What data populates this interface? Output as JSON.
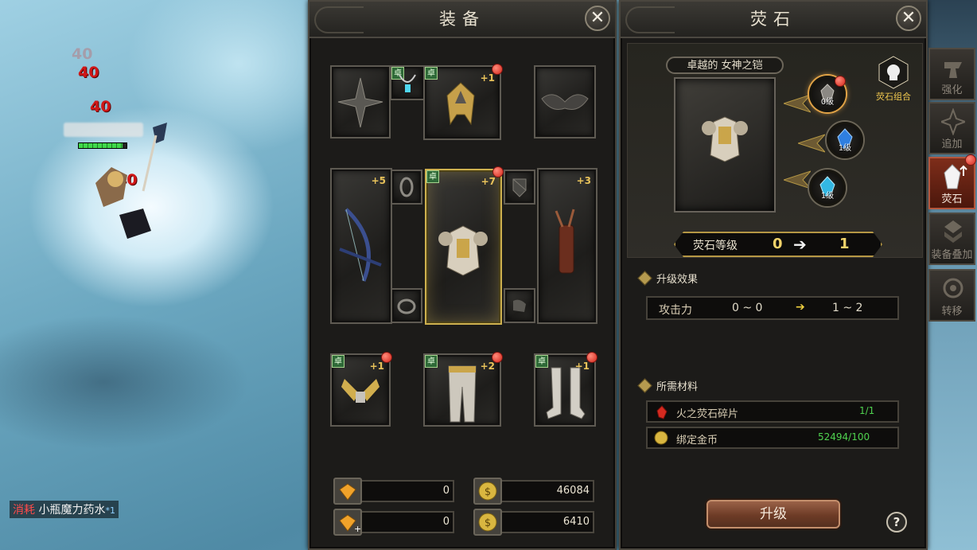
{
  "world": {
    "damage_numbers": [
      "40",
      "40",
      "40",
      "40"
    ],
    "consume": {
      "tag": "消耗",
      "item": "小瓶魔力药水",
      "count": "*1"
    },
    "hp_fraction": 0.92
  },
  "equip_panel": {
    "title": "装备",
    "close_icon": "close-icon",
    "badge_text": "卓",
    "slots": {
      "weapon_top_left": {
        "plus": ""
      },
      "necklace": {},
      "helmet": {
        "plus": "+1"
      },
      "wings": {},
      "bow": {
        "plus": "+5"
      },
      "ring_top": {},
      "armor": {
        "plus": "+7"
      },
      "shield_small": {},
      "quiver": {
        "plus": "+3"
      },
      "ring_bottom": {},
      "boots_small": {},
      "gloves": {
        "plus": "+1"
      },
      "pants": {
        "plus": "+2"
      },
      "boots": {
        "plus": "+1"
      }
    },
    "currencies": [
      {
        "icon": "gem-icon",
        "value": "0"
      },
      {
        "icon": "coin-icon",
        "value": "46084"
      },
      {
        "icon": "gem-plus-icon",
        "value": "0"
      },
      {
        "icon": "coin-icon",
        "value": "6410"
      }
    ]
  },
  "gem_panel": {
    "title": "荧石",
    "item_name": "卓越的 女神之铠",
    "combo_label": "荧石组合",
    "orbs": [
      {
        "label": "0级"
      },
      {
        "label": "1级"
      },
      {
        "label": "1级"
      }
    ],
    "level": {
      "label": "荧石等级",
      "from": "0",
      "to": "1"
    },
    "effect_title": "升级效果",
    "effect": {
      "stat": "攻击力",
      "from": "0 ~ 0",
      "to": "1 ~ 2"
    },
    "materials_title": "所需材料",
    "materials": [
      {
        "name": "火之荧石碎片",
        "amount": "1/1",
        "icon": "red-shard-icon"
      },
      {
        "name": "绑定金币",
        "amount": "52494/100",
        "icon": "gold-coin-icon"
      }
    ],
    "upgrade_label": "升级",
    "help_label": "?"
  },
  "side_tabs": [
    {
      "label": "强化",
      "icon": "anvil-icon",
      "active": false
    },
    {
      "label": "追加",
      "icon": "compass-icon",
      "active": false
    },
    {
      "label": "荧石",
      "icon": "crystal-icon",
      "active": true
    },
    {
      "label": "装备叠加",
      "icon": "stack-icon",
      "active": false
    },
    {
      "label": "转移",
      "icon": "transfer-icon",
      "active": false
    }
  ],
  "colors": {
    "accent_gold": "#e8c25a",
    "active_tab": "#7e2d1a",
    "green_amount": "#4fd24f"
  }
}
